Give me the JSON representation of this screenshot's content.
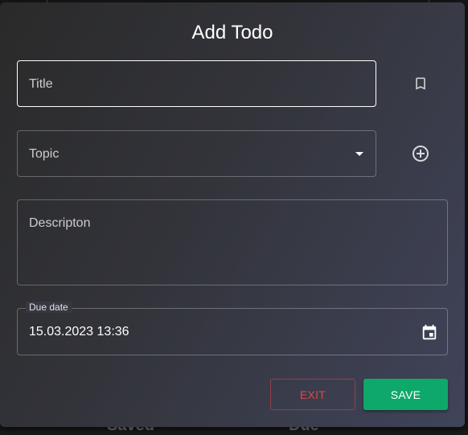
{
  "dialog": {
    "title": "Add Todo"
  },
  "form": {
    "title_placeholder": "Title",
    "topic_placeholder": "Topic",
    "description_placeholder": "Descripton",
    "due_date_label": "Due date",
    "due_date_value": "15.03.2023 13:36"
  },
  "actions": {
    "exit_label": "EXIT",
    "save_label": "SAVE"
  },
  "background": {
    "saved_label": "Saved",
    "due_label": "Due"
  },
  "icons": {
    "bookmark": "bookmark-icon",
    "add_topic": "add-circle-icon",
    "dropdown": "dropdown-arrow-icon",
    "calendar": "calendar-icon"
  },
  "colors": {
    "save_button": "#0ea86a",
    "exit_button": "#d9484a"
  }
}
